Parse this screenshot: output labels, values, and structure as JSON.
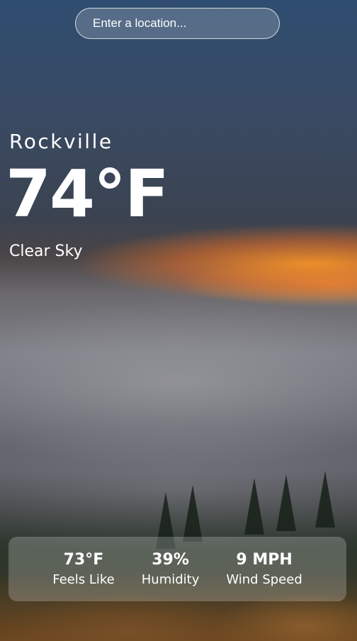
{
  "search": {
    "placeholder": "Enter a location..."
  },
  "location": {
    "city": "Rockville"
  },
  "current": {
    "temperature": "74°F",
    "condition": "Clear Sky"
  },
  "details": [
    {
      "value": "73°F",
      "label": "Feels Like"
    },
    {
      "value": "39%",
      "label": "Humidity"
    },
    {
      "value": "9 MPH",
      "label": "Wind Speed"
    }
  ]
}
